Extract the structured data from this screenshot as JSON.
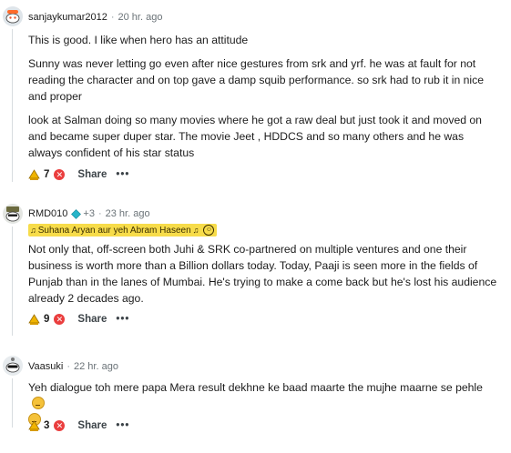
{
  "comments": [
    {
      "username": "sanjaykumar2012",
      "separator": "·",
      "time": "20 hr. ago",
      "paragraphs": [
        "This is good. I like when hero has an attitude",
        "Sunny was never letting go even after nice gestures from srk and yrf. he was at fault for not reading the character and on top gave a damp squib performance. so srk had to rub it in nice and proper",
        "look at Salman doing so many movies where he got a raw deal but just took it and moved on and became super duper star. The movie Jeet , HDDCS and so many others and he was always confident of his star status"
      ],
      "votes": "7",
      "share_label": "Share",
      "more_label": "•••"
    },
    {
      "username": "RMD010",
      "plus": "+3",
      "separator": "·",
      "time": "23 hr. ago",
      "flair": "Suhana Aryan aur yeh Abram Haseen",
      "paragraphs": [
        "Not only that, off-screen both Juhi & SRK co-partnered on multiple ventures and one their business is worth more than a Billion dollars today. Today, Paaji is seen more in the fields of Punjab than in the lanes of Mumbai. He's trying to make a come back but he's lost his audience already 2 decades ago."
      ],
      "votes": "9",
      "share_label": "Share",
      "more_label": "•••"
    },
    {
      "username": "Vaasuki",
      "separator": "·",
      "time": "22 hr. ago",
      "paragraphs": [
        "Yeh dialogue toh mere papa Mera result dekhne ke baad maarte the mujhe maarne se pehle"
      ],
      "votes": "3",
      "share_label": "Share",
      "more_label": "•••"
    }
  ],
  "colors": {
    "downvote": "#ea3e3e",
    "flair_bg": "#f7dc4a",
    "upvote": "#f0b400",
    "gem": "#27b5c9"
  },
  "icons": [
    "avatar-snoo",
    "upvote-award-icon",
    "downvote-icon",
    "more-icon",
    "gem-icon",
    "music-note-icon",
    "smiley-icon",
    "grin-emoji"
  ]
}
